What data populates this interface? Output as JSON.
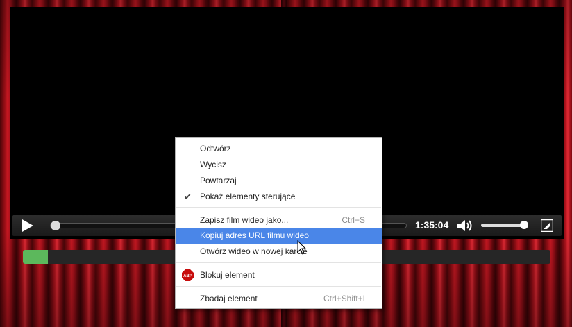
{
  "player": {
    "time_display": "1:35:04",
    "seek_fraction": 0.0,
    "volume_fraction": 1.0,
    "icons": {
      "play": "play-icon",
      "volume": "volume-icon",
      "fullscreen": "fullscreen-icon"
    }
  },
  "buffer_progress": {
    "fraction": 0.048,
    "color": "#5cb85c"
  },
  "context_menu": {
    "items": [
      {
        "label": "Odtwórz"
      },
      {
        "label": "Wycisz"
      },
      {
        "label": "Powtarzaj"
      },
      {
        "label": "Pokaż elementy sterujące",
        "checked": true
      },
      {
        "label": "Zapisz film wideo jako...",
        "shortcut": "Ctrl+S"
      },
      {
        "label": "Kopiuj adres URL filmu wideo",
        "highlighted": true
      },
      {
        "label": "Otwórz wideo w nowej karcie"
      },
      {
        "label": "Blokuj element",
        "icon": "abp-icon",
        "icon_text": "ABP"
      },
      {
        "label": "Zbadaj element",
        "shortcut": "Ctrl+Shift+I"
      }
    ],
    "highlight_color": "#4a86e8"
  },
  "colors": {
    "curtain": "#b5141e",
    "player_bg": "#000000"
  }
}
